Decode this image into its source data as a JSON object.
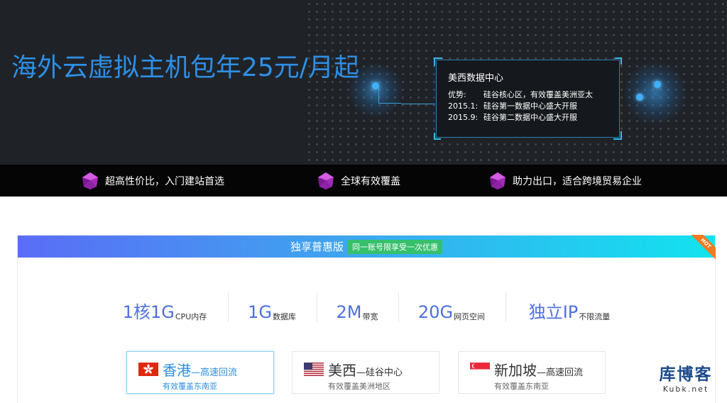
{
  "hero": {
    "title": "海外云虚拟主机包年25元/月起",
    "info": {
      "title": "美西数据中心",
      "rows": [
        {
          "key": "优势:",
          "value": "硅谷核心区，有效覆盖美洲亚太"
        },
        {
          "key": "2015.1:",
          "value": "硅谷第一数据中心盛大开服"
        },
        {
          "key": "2015.9:",
          "value": "硅谷第二数据中心盛大开服"
        }
      ]
    }
  },
  "features": [
    {
      "label": "超高性价比，入门建站首选",
      "icon": "purple-gem-icon"
    },
    {
      "label": "全球有效覆盖",
      "icon": "purple-gem-icon"
    },
    {
      "label": "助力出口，适合跨境贸易企业",
      "icon": "purple-gem-icon"
    }
  ],
  "plan": {
    "name": "独享普惠版",
    "badge": "同一账号限享受一次优惠",
    "hot": "HOT",
    "specs": [
      {
        "big": "1核1G",
        "small": "CPU内存"
      },
      {
        "big": "1G",
        "small": "数据库"
      },
      {
        "big": "2M",
        "small": "带宽"
      },
      {
        "big": "20G",
        "small": "网页空间"
      },
      {
        "big": "独立IP",
        "small": "不限流量"
      }
    ],
    "regions": [
      {
        "name": "香港",
        "tag": "—高速回流",
        "desc": "有效覆盖东南亚",
        "flag": "hong-kong-flag-icon",
        "active": true
      },
      {
        "name": "美西",
        "tag": "—硅谷中心",
        "desc": "有效覆盖美洲地区",
        "flag": "usa-flag-icon",
        "active": false
      },
      {
        "name": "新加坡",
        "tag": "—高速回流",
        "desc": "有效覆盖东南亚",
        "flag": "singapore-flag-icon",
        "active": false
      }
    ]
  },
  "watermark": {
    "cn": "库博客",
    "en": "Kubk.net"
  },
  "colors": {
    "accent": "#4d6fe0",
    "hero_title": "#2e8fe6",
    "badge": "#35c06c",
    "hot": "#f37a20"
  }
}
